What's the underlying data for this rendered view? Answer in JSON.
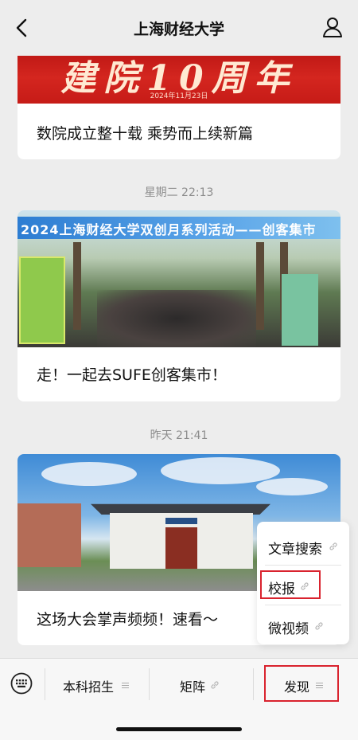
{
  "header": {
    "title": "上海财经大学",
    "back_icon": "chevron-left-icon",
    "profile_icon": "person-icon"
  },
  "articles": [
    {
      "banner_text": "建院10周年",
      "banner_date": "2024年11月23日",
      "caption": "数院成立整十载 乘势而上续新篇"
    },
    {
      "timestamp": "星期二 22:13",
      "banner_text": "2024上海财经大学双创月系列活动——创客集市",
      "caption": "走！一起去SUFE创客集市！"
    },
    {
      "timestamp": "昨天 21:41",
      "caption": "这场大会掌声频频！速看～"
    }
  ],
  "popup_menu": {
    "items": [
      {
        "label": "文章搜索",
        "icon": "link-icon"
      },
      {
        "label": "校报",
        "icon": "link-icon"
      },
      {
        "label": "微视频",
        "icon": "link-icon"
      }
    ]
  },
  "menu_bar": {
    "keyboard_icon": "keyboard-icon",
    "tabs": [
      {
        "label": "本科招生",
        "icon": "menu-lines-icon"
      },
      {
        "label": "矩阵",
        "icon": "link-icon"
      },
      {
        "label": "发现",
        "icon": "menu-lines-icon"
      }
    ]
  },
  "colors": {
    "highlight": "#d9232e",
    "background": "#ededed"
  }
}
